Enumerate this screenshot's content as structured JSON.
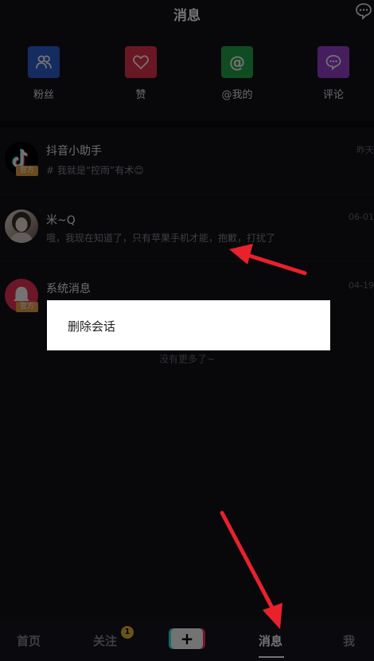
{
  "header": {
    "title": "消息"
  },
  "quick_actions": [
    {
      "label": "粉丝",
      "icon": "fans-icon",
      "color": "#2f62d4"
    },
    {
      "label": "赞",
      "icon": "heart-icon",
      "color": "#e8334f"
    },
    {
      "label": "@我的",
      "icon": "at-icon",
      "color": "#23a84a"
    },
    {
      "label": "评论",
      "icon": "comment-icon",
      "color": "#9b43d6"
    }
  ],
  "conversations": [
    {
      "name": "抖音小助手",
      "preview": "# 我就是“控雨”有术😊",
      "time": "昨天",
      "badge": "官方",
      "avatar": "tiktok-logo-icon"
    },
    {
      "name": "米~Q",
      "preview": "哦，我现在知道了，只有苹果手机才能，抱歉，打扰了",
      "time": "06-01",
      "avatar": "user-photo"
    },
    {
      "name": "系统消息",
      "preview": "",
      "time": "04-19",
      "badge": "官方",
      "avatar": "bell-icon"
    }
  ],
  "no_more": "没有更多了~",
  "dialog": {
    "item": "删除会话"
  },
  "nav": {
    "home": "首页",
    "follow": "关注",
    "follow_count": "1",
    "plus": "+",
    "messages": "消息",
    "me": "我"
  }
}
